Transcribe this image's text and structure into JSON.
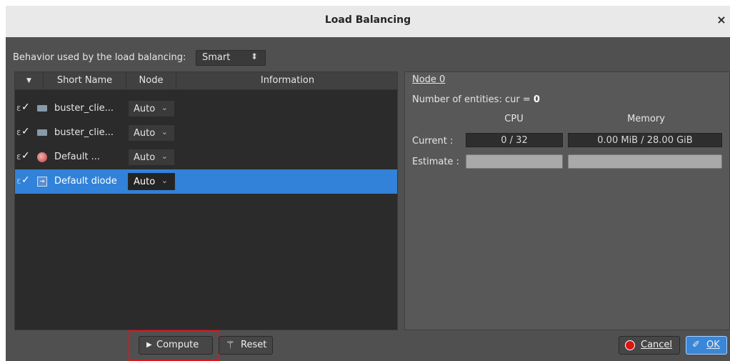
{
  "window": {
    "title": "Load Balancing",
    "close_glyph": "×"
  },
  "behavior": {
    "label": "Behavior used by the load balancing:",
    "value": "Smart",
    "arrow_glyph": "⬍"
  },
  "table": {
    "headers": {
      "sort_glyph": "▼",
      "short_name": "Short Name",
      "node": "Node",
      "information": "Information"
    },
    "rows": [
      {
        "check_prefix": "ɛ",
        "check": "✓",
        "icon": "monitor-icon",
        "name": "buster_clie...",
        "node": "Auto",
        "arrow": "⌄",
        "selected": false
      },
      {
        "check_prefix": "ɛ",
        "check": "✓",
        "icon": "monitor-icon",
        "name": "buster_clie...",
        "node": "Auto",
        "arrow": "⌄",
        "selected": false
      },
      {
        "check_prefix": "ɛ",
        "check": "✓",
        "icon": "ball-icon",
        "name": "Default ...",
        "node": "Auto",
        "arrow": "⌄",
        "selected": false
      },
      {
        "check_prefix": "ɛ",
        "check": "✓",
        "icon": "diode-icon",
        "name": "Default diode",
        "node": "Auto",
        "arrow": "⌄",
        "selected": true
      }
    ]
  },
  "panel": {
    "node_title": "Node 0",
    "entities_label": "Number of entities: cur = ",
    "entities_value": "0",
    "col_cpu": "CPU",
    "col_memory": "Memory",
    "current_label": "Current :",
    "estimate_label": "Estimate :",
    "current_cpu": "0 / 32",
    "current_memory": "0.00 MiB / 28.00 GiB"
  },
  "footer": {
    "compute_label": "Compute",
    "compute_glyph": "▶",
    "reset_label": "Reset",
    "reset_glyph": "⚚",
    "cancel_label": "Cancel",
    "ok_label": "OK",
    "ok_glyph": "✐"
  },
  "colors": {
    "dialog_bg": "#505050",
    "selection": "#3182d8",
    "highlight": "#e0141e",
    "ok_button": "#3a86d8"
  }
}
